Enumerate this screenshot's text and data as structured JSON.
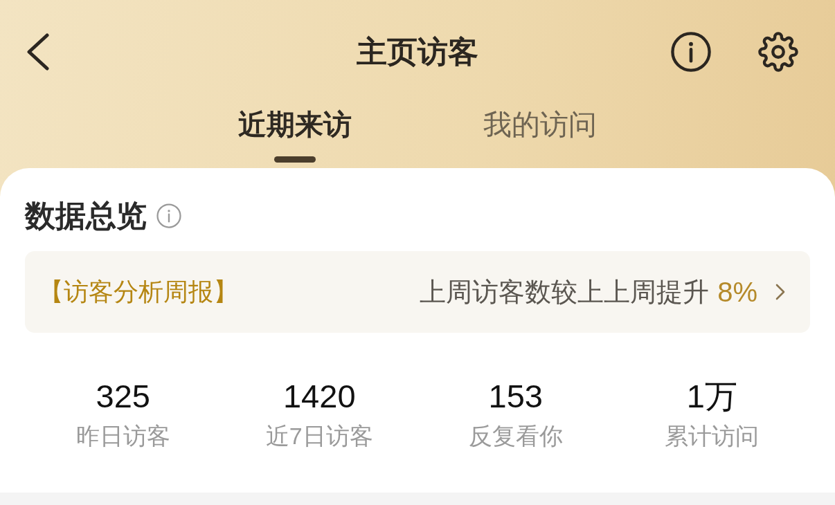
{
  "header": {
    "title": "主页访客"
  },
  "tabs": [
    {
      "label": "近期来访",
      "selected": true
    },
    {
      "label": "我的访问",
      "selected": false
    }
  ],
  "overview": {
    "title": "数据总览"
  },
  "weekly_report": {
    "title": "【访客分析周报】",
    "summary": "上周访客数较上上周提升",
    "change": "8%"
  },
  "stats": [
    {
      "value": "325",
      "label": "昨日访客"
    },
    {
      "value": "1420",
      "label": "近7日访客"
    },
    {
      "value": "153",
      "label": "反复看你"
    },
    {
      "value": "1万",
      "label": "累计访问"
    }
  ]
}
